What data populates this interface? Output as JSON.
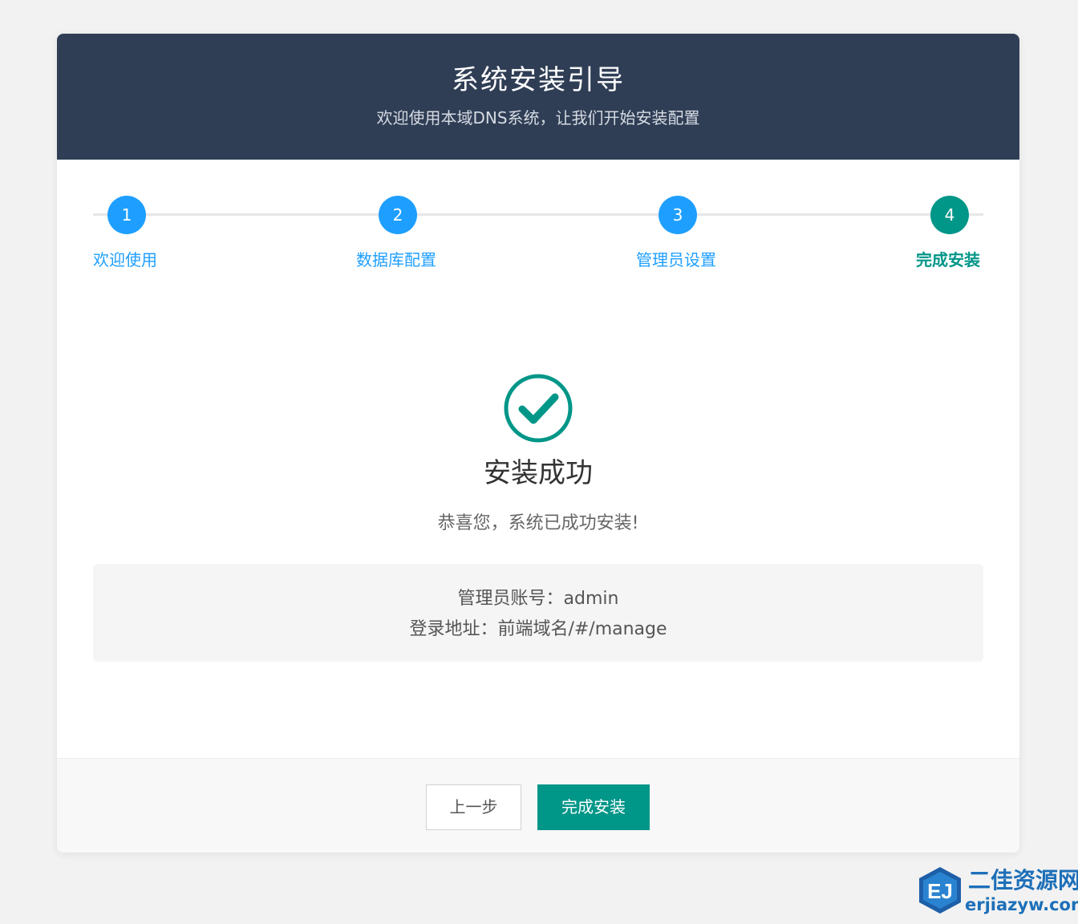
{
  "header": {
    "title": "系统安装引导",
    "subtitle": "欢迎使用本域DNS系统，让我们开始安装配置"
  },
  "steps": [
    {
      "number": "1",
      "label": "欢迎使用",
      "state": "done"
    },
    {
      "number": "2",
      "label": "数据库配置",
      "state": "done"
    },
    {
      "number": "3",
      "label": "管理员设置",
      "state": "done"
    },
    {
      "number": "4",
      "label": "完成安装",
      "state": "active"
    }
  ],
  "result": {
    "icon": "check-circle-icon",
    "title": "安装成功",
    "message": "恭喜您，系统已成功安装!",
    "admin_account": "管理员账号：admin",
    "login_url": "登录地址：前端域名/#/manage"
  },
  "footer": {
    "prev_label": "上一步",
    "finish_label": "完成安装"
  },
  "watermark": {
    "logo_text": "EJ",
    "title": "二佳资源网",
    "url": "erjiazyw.com"
  },
  "colors": {
    "header_bg": "#2f3e55",
    "step_done": "#1e9fff",
    "step_active": "#009688",
    "primary_button": "#009688",
    "page_bg": "#f2f2f2"
  }
}
